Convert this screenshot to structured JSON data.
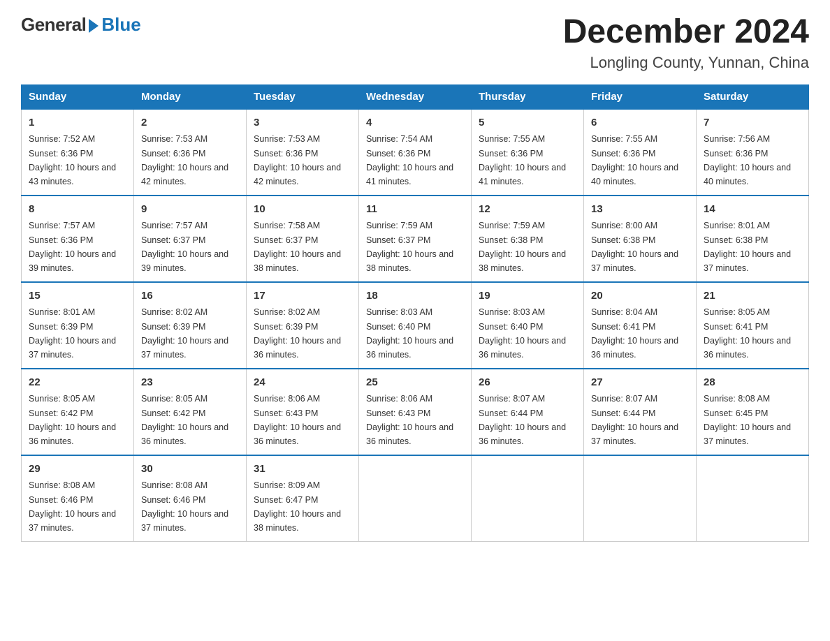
{
  "logo": {
    "general": "General",
    "blue": "Blue"
  },
  "title": "December 2024",
  "subtitle": "Longling County, Yunnan, China",
  "days_of_week": [
    "Sunday",
    "Monday",
    "Tuesday",
    "Wednesday",
    "Thursday",
    "Friday",
    "Saturday"
  ],
  "weeks": [
    [
      {
        "day": "1",
        "sunrise": "7:52 AM",
        "sunset": "6:36 PM",
        "daylight": "10 hours and 43 minutes."
      },
      {
        "day": "2",
        "sunrise": "7:53 AM",
        "sunset": "6:36 PM",
        "daylight": "10 hours and 42 minutes."
      },
      {
        "day": "3",
        "sunrise": "7:53 AM",
        "sunset": "6:36 PM",
        "daylight": "10 hours and 42 minutes."
      },
      {
        "day": "4",
        "sunrise": "7:54 AM",
        "sunset": "6:36 PM",
        "daylight": "10 hours and 41 minutes."
      },
      {
        "day": "5",
        "sunrise": "7:55 AM",
        "sunset": "6:36 PM",
        "daylight": "10 hours and 41 minutes."
      },
      {
        "day": "6",
        "sunrise": "7:55 AM",
        "sunset": "6:36 PM",
        "daylight": "10 hours and 40 minutes."
      },
      {
        "day": "7",
        "sunrise": "7:56 AM",
        "sunset": "6:36 PM",
        "daylight": "10 hours and 40 minutes."
      }
    ],
    [
      {
        "day": "8",
        "sunrise": "7:57 AM",
        "sunset": "6:36 PM",
        "daylight": "10 hours and 39 minutes."
      },
      {
        "day": "9",
        "sunrise": "7:57 AM",
        "sunset": "6:37 PM",
        "daylight": "10 hours and 39 minutes."
      },
      {
        "day": "10",
        "sunrise": "7:58 AM",
        "sunset": "6:37 PM",
        "daylight": "10 hours and 38 minutes."
      },
      {
        "day": "11",
        "sunrise": "7:59 AM",
        "sunset": "6:37 PM",
        "daylight": "10 hours and 38 minutes."
      },
      {
        "day": "12",
        "sunrise": "7:59 AM",
        "sunset": "6:38 PM",
        "daylight": "10 hours and 38 minutes."
      },
      {
        "day": "13",
        "sunrise": "8:00 AM",
        "sunset": "6:38 PM",
        "daylight": "10 hours and 37 minutes."
      },
      {
        "day": "14",
        "sunrise": "8:01 AM",
        "sunset": "6:38 PM",
        "daylight": "10 hours and 37 minutes."
      }
    ],
    [
      {
        "day": "15",
        "sunrise": "8:01 AM",
        "sunset": "6:39 PM",
        "daylight": "10 hours and 37 minutes."
      },
      {
        "day": "16",
        "sunrise": "8:02 AM",
        "sunset": "6:39 PM",
        "daylight": "10 hours and 37 minutes."
      },
      {
        "day": "17",
        "sunrise": "8:02 AM",
        "sunset": "6:39 PM",
        "daylight": "10 hours and 36 minutes."
      },
      {
        "day": "18",
        "sunrise": "8:03 AM",
        "sunset": "6:40 PM",
        "daylight": "10 hours and 36 minutes."
      },
      {
        "day": "19",
        "sunrise": "8:03 AM",
        "sunset": "6:40 PM",
        "daylight": "10 hours and 36 minutes."
      },
      {
        "day": "20",
        "sunrise": "8:04 AM",
        "sunset": "6:41 PM",
        "daylight": "10 hours and 36 minutes."
      },
      {
        "day": "21",
        "sunrise": "8:05 AM",
        "sunset": "6:41 PM",
        "daylight": "10 hours and 36 minutes."
      }
    ],
    [
      {
        "day": "22",
        "sunrise": "8:05 AM",
        "sunset": "6:42 PM",
        "daylight": "10 hours and 36 minutes."
      },
      {
        "day": "23",
        "sunrise": "8:05 AM",
        "sunset": "6:42 PM",
        "daylight": "10 hours and 36 minutes."
      },
      {
        "day": "24",
        "sunrise": "8:06 AM",
        "sunset": "6:43 PM",
        "daylight": "10 hours and 36 minutes."
      },
      {
        "day": "25",
        "sunrise": "8:06 AM",
        "sunset": "6:43 PM",
        "daylight": "10 hours and 36 minutes."
      },
      {
        "day": "26",
        "sunrise": "8:07 AM",
        "sunset": "6:44 PM",
        "daylight": "10 hours and 36 minutes."
      },
      {
        "day": "27",
        "sunrise": "8:07 AM",
        "sunset": "6:44 PM",
        "daylight": "10 hours and 37 minutes."
      },
      {
        "day": "28",
        "sunrise": "8:08 AM",
        "sunset": "6:45 PM",
        "daylight": "10 hours and 37 minutes."
      }
    ],
    [
      {
        "day": "29",
        "sunrise": "8:08 AM",
        "sunset": "6:46 PM",
        "daylight": "10 hours and 37 minutes."
      },
      {
        "day": "30",
        "sunrise": "8:08 AM",
        "sunset": "6:46 PM",
        "daylight": "10 hours and 37 minutes."
      },
      {
        "day": "31",
        "sunrise": "8:09 AM",
        "sunset": "6:47 PM",
        "daylight": "10 hours and 38 minutes."
      },
      null,
      null,
      null,
      null
    ]
  ],
  "labels": {
    "sunrise_prefix": "Sunrise: ",
    "sunset_prefix": "Sunset: ",
    "daylight_prefix": "Daylight: "
  }
}
